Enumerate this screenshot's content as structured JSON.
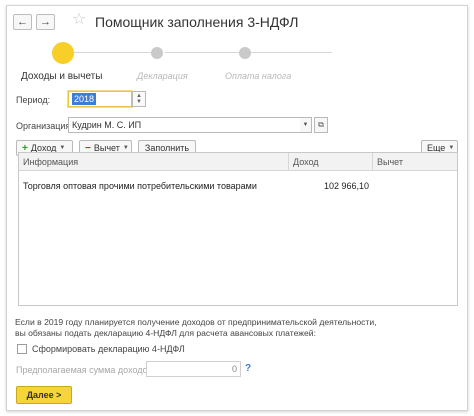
{
  "header": {
    "title": "Помощник заполнения 3-НДФЛ",
    "back_icon": "←",
    "forward_icon": "→",
    "favorite_icon": "☆"
  },
  "steps": [
    {
      "label": "Доходы и вычеты",
      "state": "active"
    },
    {
      "label": "Декларация",
      "state": "inactive"
    },
    {
      "label": "Оплата налога",
      "state": "inactive"
    }
  ],
  "form": {
    "period_label": "Период:",
    "period_value": "2018",
    "organization_label": "Организация:",
    "organization_value": "Кудрин М. С. ИП"
  },
  "toolbar": {
    "income_label": "Доход",
    "deduction_label": "Вычет",
    "fill_label": "Заполнить",
    "more_label": "Еще"
  },
  "table": {
    "columns": [
      "Информация",
      "Доход",
      "Вычет"
    ],
    "rows": [
      {
        "info": "Торговля оптовая прочими потребительскими товарами",
        "income": "102 966,10",
        "deduction": ""
      }
    ]
  },
  "footer": {
    "note_line1": "Если в 2019 году планируется получение доходов от предпринимательской деятельности,",
    "note_line2": "вы обязаны подать декларацию 4-НДФЛ для расчета авансовых платежей:",
    "checkbox_label": "Сформировать декларацию 4-НДФЛ",
    "checkbox_checked": false,
    "expected_income_label": "Предполагаемая сумма доходов:",
    "expected_income_value": "0",
    "help_label": "?",
    "next_label": "Далее >"
  },
  "colors": {
    "accent": "#f6d53a",
    "selection": "#3b7dd8",
    "income_icon": "#2a9c2a",
    "deduction_icon": "#d62020",
    "help": "#3b7dd8"
  }
}
